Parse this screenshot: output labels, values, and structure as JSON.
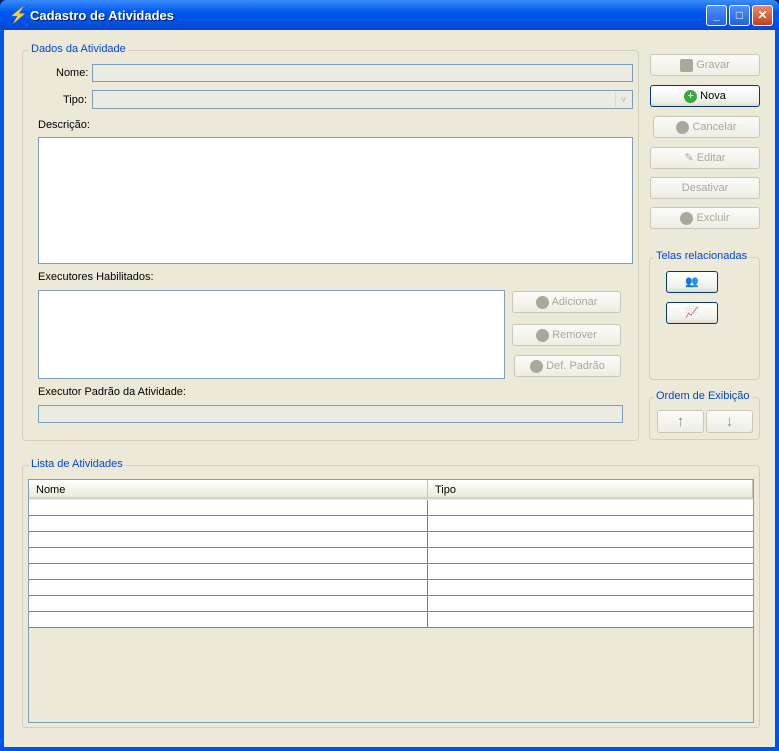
{
  "window": {
    "title": "Cadastro de Atividades",
    "icon": "lightning-icon"
  },
  "dados": {
    "legend": "Dados da Atividade",
    "nome_label": "Nome:",
    "nome_value": "",
    "tipo_label": "Tipo:",
    "tipo_value": "",
    "descricao_label": "Descrição:",
    "executores_label": "Executores Habilitados:",
    "executor_padrao_label": "Executor Padrão da Atividade:",
    "executor_padrao_value": "",
    "adicionar": "Adicionar",
    "remover": "Remover",
    "def_padrao": "Def. Padrão"
  },
  "actions": {
    "gravar": "Gravar",
    "nova": "Nova",
    "cancelar": "Cancelar",
    "editar": "Editar",
    "desativar": "Desativar",
    "excluir": "Excluir"
  },
  "telas": {
    "legend": "Telas relacionadas"
  },
  "ordem": {
    "legend": "Ordem de Exibição",
    "up": "↑",
    "down": "↓"
  },
  "lista": {
    "legend": "Lista de Atividades",
    "columns": [
      "Nome",
      "Tipo"
    ],
    "row_count": 8
  }
}
